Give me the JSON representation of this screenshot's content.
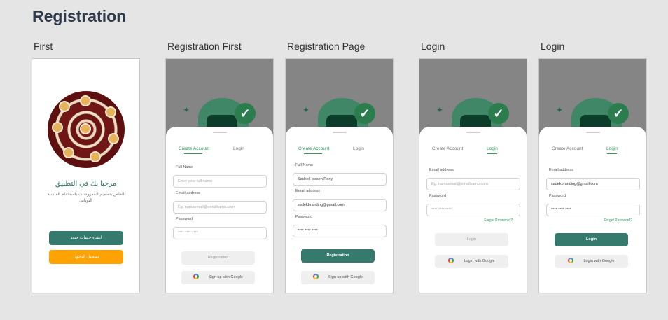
{
  "page_title": "Registration",
  "frames": [
    {
      "label": "First",
      "welcome": "مرحبا بك في التطبيق",
      "subtitle": "القاص بتصميم المفروشات باستخدام القاشية اليونانى",
      "btn_new_account": "انشاء حساب جديد",
      "btn_login": "تسجيل الدخول"
    },
    {
      "label": "Registration First",
      "tab_create": "Create Account",
      "tab_login": "Login",
      "fullname_label": "Full Name",
      "fullname_value": "Enter your full name",
      "email_label": "Email address",
      "email_value": "Eg. namaemail@emailkamu.com",
      "password_label": "Password",
      "password_value": "**** **** ****",
      "btn_primary": "Registration",
      "btn_google": "Sign up with Google"
    },
    {
      "label": "Registration Page",
      "tab_create": "Create Account",
      "tab_login": "Login",
      "fullname_label": "Full Name",
      "fullname_value": "Sadek Hossen Rony",
      "email_label": "Email address",
      "email_value": "sadekbranding@gmail.com",
      "password_label": "Password",
      "password_value": "**** **** ****",
      "btn_primary": "Registration",
      "btn_google": "Sign up with Google"
    },
    {
      "label": "Login",
      "tab_create": "Create Account",
      "tab_login": "Login",
      "email_label": "Email address",
      "email_value": "Eg. namaemail@emailkamu.com",
      "password_label": "Password",
      "password_value": "**** **** ****",
      "forgot": "Forget Password?",
      "btn_primary": "Login",
      "btn_google": "Login with Google"
    },
    {
      "label": "Login",
      "tab_create": "Create Account",
      "tab_login": "Login",
      "email_label": "Email address",
      "email_value": "sadekbranding@gmail.com",
      "password_label": "Password",
      "password_value": "**** **** ****",
      "forgot": "Forget Password?",
      "btn_primary": "Login",
      "btn_google": "Login with Google"
    }
  ]
}
